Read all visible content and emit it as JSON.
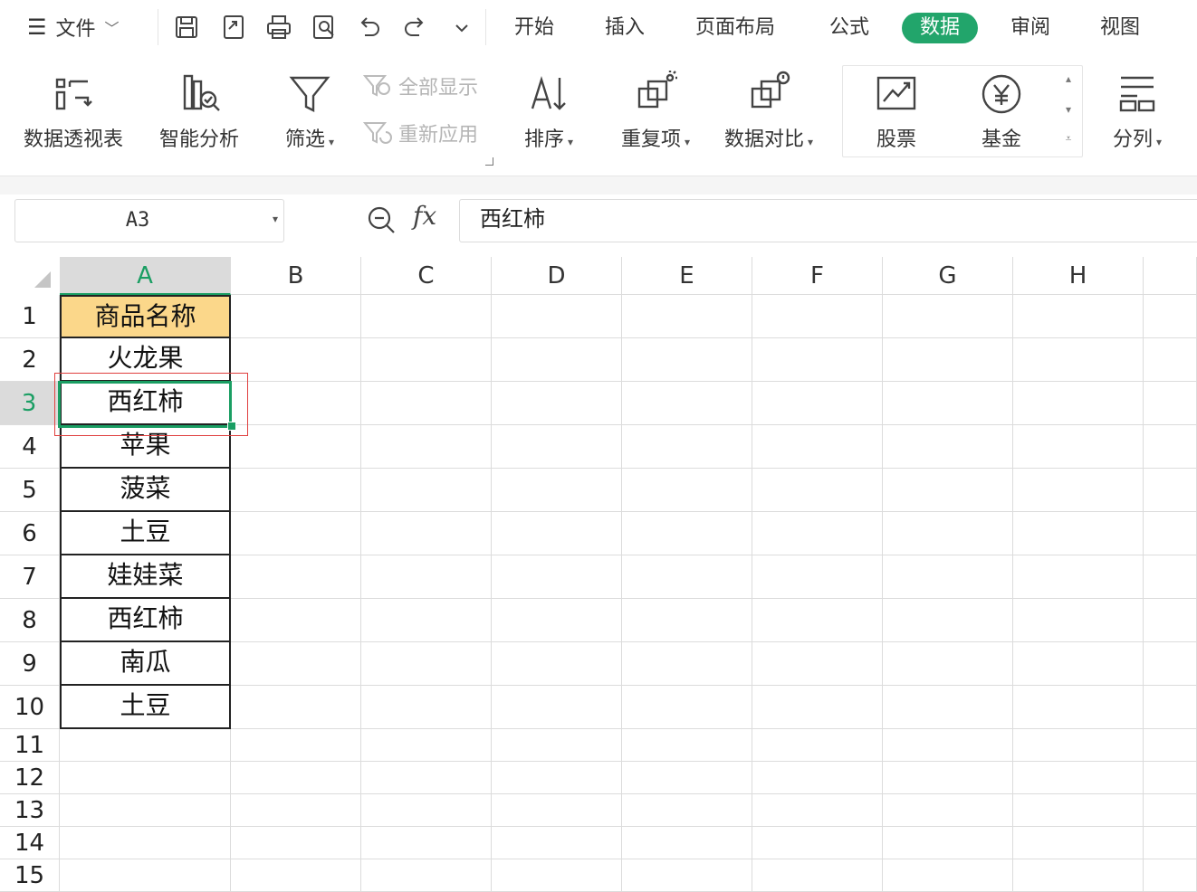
{
  "menubar": {
    "file_label": "文件",
    "tabs": [
      {
        "label": "开始"
      },
      {
        "label": "插入"
      },
      {
        "label": "页面布局"
      },
      {
        "label": "公式"
      },
      {
        "label": "数据",
        "active": true
      },
      {
        "label": "审阅"
      },
      {
        "label": "视图"
      }
    ]
  },
  "ribbon": {
    "pivot": "数据透视表",
    "smart_analysis": "智能分析",
    "filter": "筛选",
    "show_all": "全部显示",
    "reapply": "重新应用",
    "sort": "排序",
    "duplicates": "重复项",
    "compare": "数据对比",
    "stocks": "股票",
    "funds": "基金",
    "split": "分列"
  },
  "formula_bar": {
    "name_box": "A3",
    "fx": "fx",
    "value": "西红柿"
  },
  "sheet": {
    "columns": [
      "A",
      "B",
      "C",
      "D",
      "E",
      "F",
      "G",
      "H"
    ],
    "rows": [
      "1",
      "2",
      "3",
      "4",
      "5",
      "6",
      "7",
      "8",
      "9",
      "10",
      "11",
      "12",
      "13",
      "14",
      "15"
    ],
    "selected_cell": "A3",
    "column_a": [
      "商品名称",
      "火龙果",
      "西红柿",
      "苹果",
      "菠菜",
      "土豆",
      "娃娃菜",
      "西红柿",
      "南瓜",
      "土豆"
    ]
  },
  "colors": {
    "accent": "#1a9e63",
    "active_tab": "#22a56b",
    "header_fill": "#fbd78a",
    "highlight_box": "#e0403f"
  }
}
